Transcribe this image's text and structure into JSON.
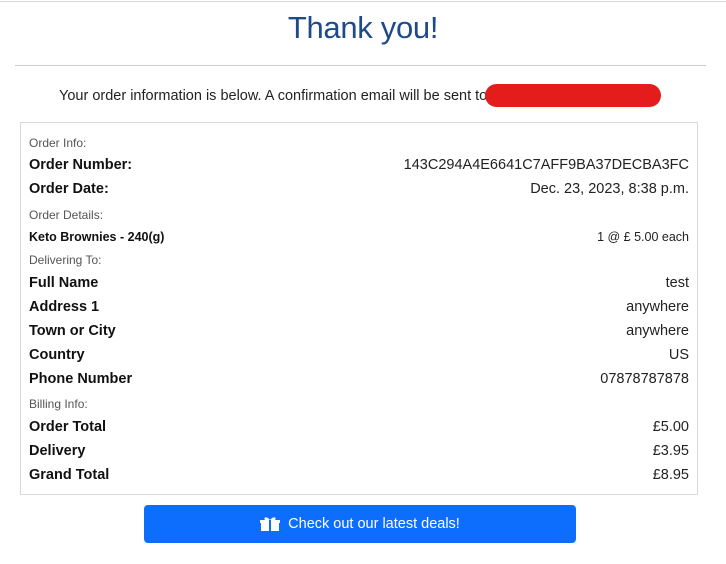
{
  "page": {
    "title": "Thank you!",
    "intro_text": "Your order information is below. A confirmation email will be sent to"
  },
  "order_info": {
    "section_label": "Order Info:",
    "order_number_label": "Order Number:",
    "order_number": "143C294A4E6641C7AFF9BA37DECBA3FC",
    "order_date_label": "Order Date:",
    "order_date": "Dec. 23, 2023, 8:38 p.m."
  },
  "order_details": {
    "section_label": "Order Details:",
    "items": [
      {
        "name": "Keto Brownies - 240(g)",
        "qty_price": "1 @ £ 5.00 each"
      }
    ]
  },
  "delivering_to": {
    "section_label": "Delivering To:",
    "fields": [
      {
        "label": "Full Name",
        "value": "test"
      },
      {
        "label": "Address 1",
        "value": "anywhere"
      },
      {
        "label": "Town or City",
        "value": "anywhere"
      },
      {
        "label": "Country",
        "value": "US"
      },
      {
        "label": "Phone Number",
        "value": "07878787878"
      }
    ]
  },
  "billing_info": {
    "section_label": "Billing Info:",
    "fields": [
      {
        "label": "Order Total",
        "value": "£5.00"
      },
      {
        "label": "Delivery",
        "value": "£3.95"
      },
      {
        "label": "Grand Total",
        "value": "£8.95"
      }
    ]
  },
  "deals_button": {
    "label": "Check out our latest deals!",
    "icon": "gift-icon"
  },
  "colors": {
    "title": "#1f4a8a",
    "button": "#0d6efd",
    "redaction": "#e41c1c"
  }
}
